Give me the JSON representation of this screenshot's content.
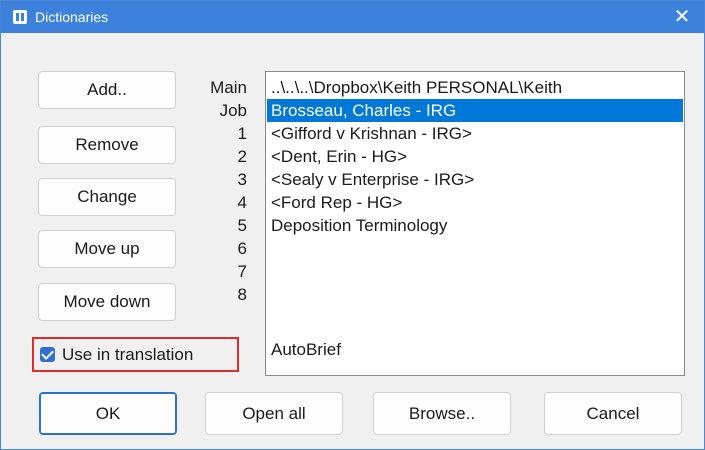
{
  "window": {
    "title": "Dictionaries",
    "close_glyph": "✕"
  },
  "side_buttons": {
    "add": "Add..",
    "remove": "Remove",
    "change": "Change",
    "move_up": "Move up",
    "move_down": "Move down"
  },
  "row_labels": [
    "Main",
    "Job",
    "1",
    "2",
    "3",
    "4",
    "5",
    "6",
    "7",
    "8"
  ],
  "list_items": [
    "..\\..\\..\\Dropbox\\Keith PERSONAL\\Keith",
    "Brosseau, Charles - IRG",
    "<Gifford v Krishnan - IRG>",
    "<Dent, Erin - HG>",
    "<Sealy v Enterprise - IRG>",
    "<Ford Rep - HG>",
    "Deposition Terminology"
  ],
  "autobrief": "AutoBrief",
  "use_in_translation": {
    "label": "Use in translation",
    "checked": true
  },
  "bottom_buttons": {
    "ok": "OK",
    "open_all": "Open all",
    "browse": "Browse..",
    "cancel": "Cancel"
  },
  "colors": {
    "titlebar": "#3c82dc",
    "selection": "#0078d7",
    "highlight_box": "#e22b2b"
  }
}
